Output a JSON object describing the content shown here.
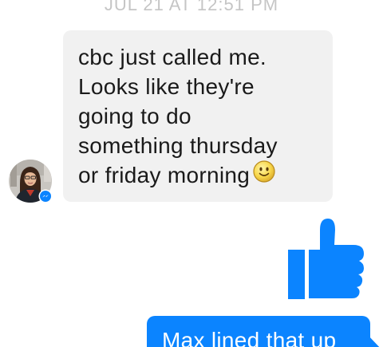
{
  "conversation": {
    "timestamp": "JUL 21 AT 12:51 PM",
    "incoming_message": {
      "lines": [
        "cbc just called me.",
        "Looks like they're",
        "going to do",
        "something thursday",
        "or friday morning"
      ],
      "emoji": "slightly-smiling-face-icon",
      "sender_badge": "messenger-icon"
    },
    "like_sticker": "thumbs-up-icon",
    "outgoing_message": {
      "text": "Max lined that up"
    }
  },
  "colors": {
    "incoming_bubble": "#f1f1f1",
    "outgoing_bubble": "#0b84ff",
    "like": "#0b84ff",
    "timestamp": "#c5c5c5"
  }
}
